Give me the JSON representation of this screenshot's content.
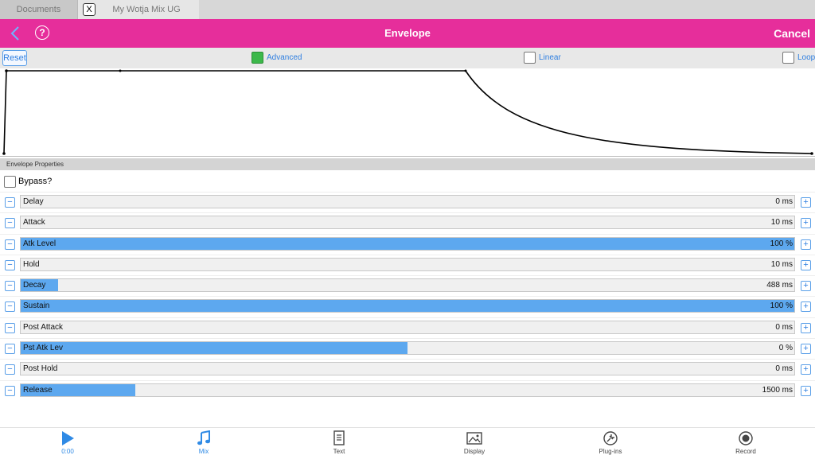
{
  "tabs": {
    "documents": "Documents",
    "close": "X",
    "doc_title": "My Wotja Mix UG"
  },
  "nav": {
    "help": "?",
    "title": "Envelope",
    "cancel": "Cancel"
  },
  "toolbar": {
    "reset": "Reset",
    "advanced": {
      "label": "Advanced",
      "checked": true
    },
    "linear": {
      "label": "Linear",
      "checked": false
    },
    "loop": {
      "label": "Loop",
      "checked": false
    }
  },
  "section_title": "Envelope Properties",
  "bypass": {
    "label": "Bypass?",
    "checked": false
  },
  "rows": [
    {
      "label": "Delay",
      "value": "0 ms",
      "fill": 0.0
    },
    {
      "label": "Attack",
      "value": "10 ms",
      "fill": 0.0
    },
    {
      "label": "Atk Level",
      "value": "100 %",
      "fill": 1.0
    },
    {
      "label": "Hold",
      "value": "10 ms",
      "fill": 0.0
    },
    {
      "label": "Decay",
      "value": "488 ms",
      "fill": 0.048
    },
    {
      "label": "Sustain",
      "value": "100 %",
      "fill": 1.0
    },
    {
      "label": "Post Attack",
      "value": "0 ms",
      "fill": 0.0
    },
    {
      "label": "Pst Atk Lev",
      "value": "0 %",
      "fill": 0.5
    },
    {
      "label": "Post Hold",
      "value": "0 ms",
      "fill": 0.0
    },
    {
      "label": "Release",
      "value": "1500 ms",
      "fill": 0.148
    }
  ],
  "tabbar": [
    {
      "label": "0:00",
      "icon": "play-icon",
      "active": true
    },
    {
      "label": "Mix",
      "icon": "music-note-icon",
      "active": true
    },
    {
      "label": "Text",
      "icon": "document-icon",
      "active": false
    },
    {
      "label": "Display",
      "icon": "image-icon",
      "active": false
    },
    {
      "label": "Plug-ins",
      "icon": "plugin-icon",
      "active": false
    },
    {
      "label": "Record",
      "icon": "record-icon",
      "active": false
    }
  ],
  "colors": {
    "nav": "#e62e9b",
    "accent": "#2f8ae5",
    "fill": "#5da8ef",
    "checked": "#3cb84a"
  }
}
